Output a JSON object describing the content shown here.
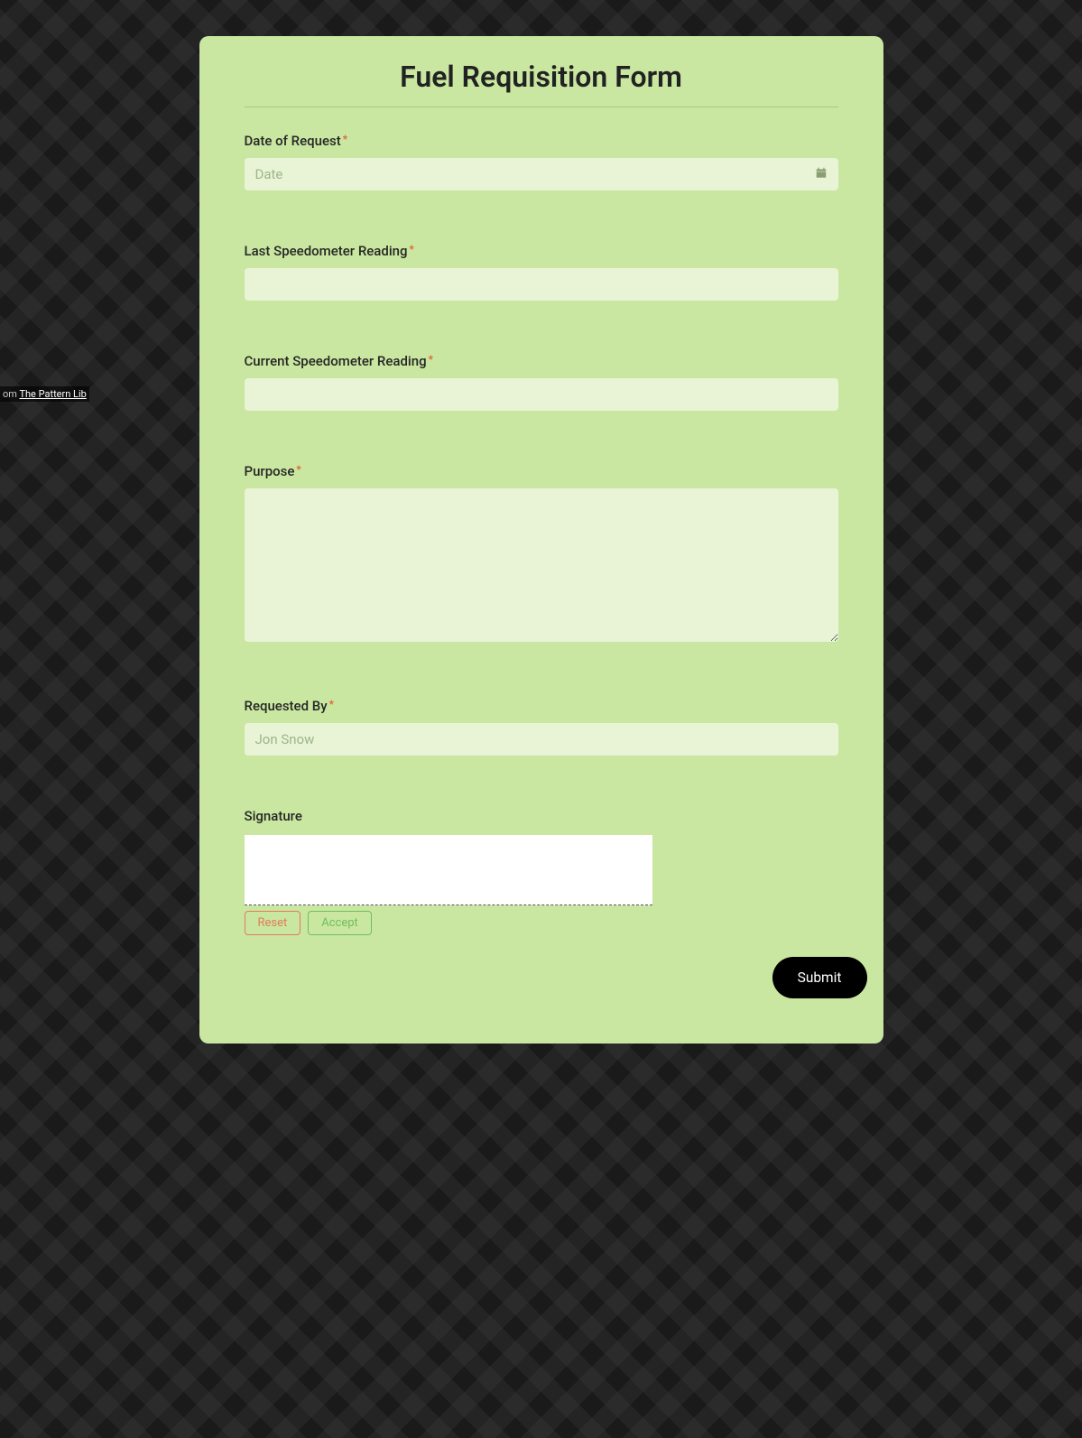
{
  "credit": {
    "prefix": "om ",
    "link_text": "The Pattern Lib"
  },
  "form": {
    "title": "Fuel Requisition Form",
    "fields": {
      "date_request": {
        "label": "Date of Request",
        "placeholder": "Date",
        "value": "",
        "required": true
      },
      "last_speedo": {
        "label": "Last Speedometer Reading",
        "value": "",
        "required": true
      },
      "current_speedo": {
        "label": "Current Speedometer Reading",
        "value": "",
        "required": true
      },
      "purpose": {
        "label": "Purpose",
        "value": "",
        "required": true
      },
      "requested_by": {
        "label": "Requested By",
        "placeholder": "Jon Snow",
        "value": "",
        "required": true
      },
      "signature": {
        "label": "Signature",
        "required": false
      }
    },
    "buttons": {
      "reset": "Reset",
      "accept": "Accept",
      "submit": "Submit"
    },
    "required_marker": "*"
  }
}
